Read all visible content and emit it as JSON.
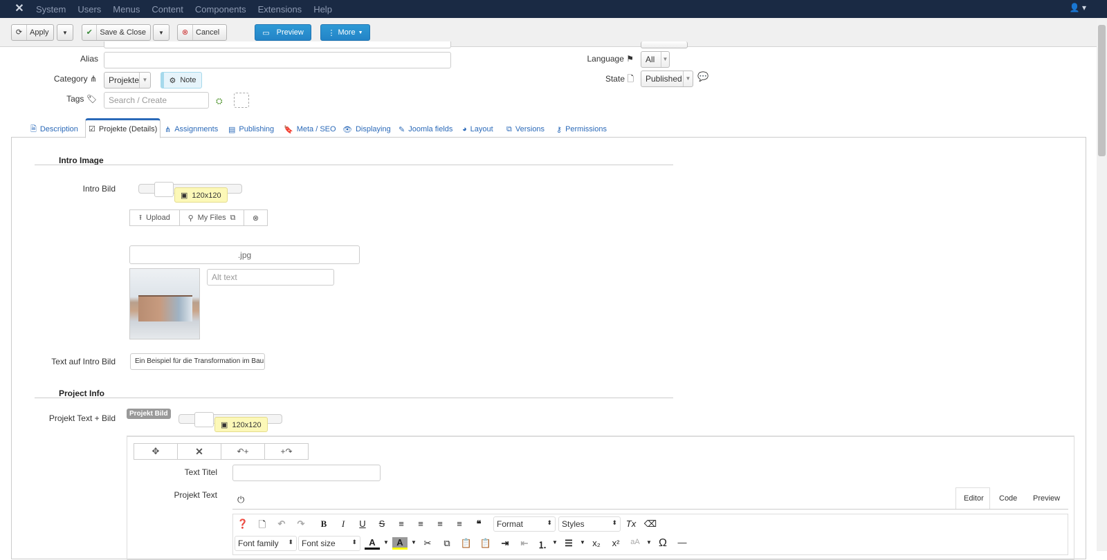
{
  "topnav": {
    "menus": [
      "System",
      "Users",
      "Menus",
      "Content",
      "Components",
      "Extensions",
      "Help"
    ]
  },
  "toolbar": {
    "apply": "Apply",
    "save_close": "Save & Close",
    "cancel": "Cancel",
    "preview": "Preview",
    "more": "More"
  },
  "form": {
    "alias_label": "Alias",
    "alias_value": "",
    "category_label": "Category",
    "category_value": "Projekte",
    "note_label": "Note",
    "tags_label": "Tags",
    "tags_placeholder": "Search / Create",
    "language_label": "Language",
    "language_value": "All",
    "state_label": "State",
    "state_value": "Published"
  },
  "tabs": [
    "Description",
    "Projekte (Details)",
    "Assignments",
    "Publishing",
    "Meta / SEO",
    "Displaying",
    "Joomla fields",
    "Layout",
    "Versions",
    "Permissions"
  ],
  "intro": {
    "section_title": "Intro Image",
    "intro_bild_label": "Intro Bild",
    "size_tip": "120x120",
    "upload": "Upload",
    "my_files": "My Files",
    "file_ext": ".jpg",
    "alt_placeholder": "Alt text",
    "text_label": "Text auf Intro Bild",
    "text_value": "Ein Beispiel für die Transformation im Bau"
  },
  "project": {
    "section_title": "Project Info",
    "label": "Projekt Text + Bild",
    "badge": "Projekt Bild",
    "size_tip": "120x120",
    "text_titel_label": "Text Titel",
    "projekt_text_label": "Projekt Text",
    "editor_tabs": [
      "Editor",
      "Code",
      "Preview"
    ],
    "format_label": "Format",
    "styles_label": "Styles",
    "font_family_label": "Font family",
    "font_size_label": "Font size"
  }
}
